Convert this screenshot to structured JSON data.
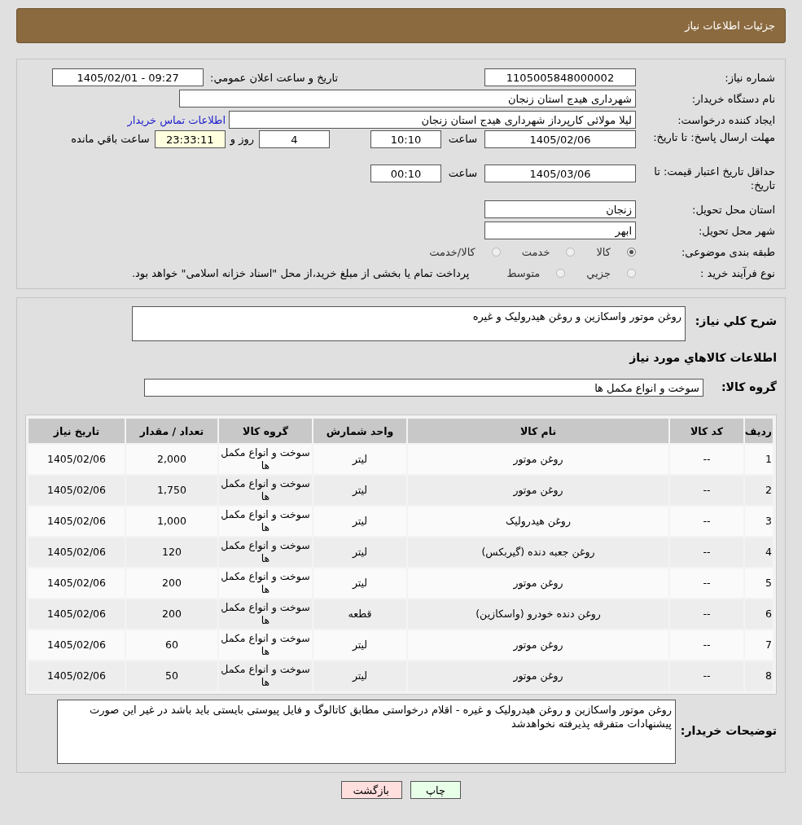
{
  "header": {
    "title": "جزئیات اطلاعات نیاز"
  },
  "info": {
    "need_number": {
      "label": "شماره نیاز:",
      "value": "1105005848000002"
    },
    "announce": {
      "label": "تاریخ و ساعت اعلان عمومي:",
      "value": "1405/02/01 - 09:27"
    },
    "buyer_org": {
      "label": "نام دستگاه خریدار:",
      "value": "شهرداری هیدج استان زنجان"
    },
    "requester": {
      "label": "ایجاد کننده درخواست:",
      "value": "لیلا مولائی کارپرداز شهرداری هیدج استان زنجان",
      "link": "اطلاعات تماس خریدار"
    },
    "deadline": {
      "label": "مهلت ارسال پاسخ: تا تاریخ:",
      "date": "1405/02/06",
      "time_label": "ساعت",
      "time": "10:10",
      "days": "4",
      "days_label": "روز و",
      "remaining": "23:33:11",
      "remaining_label": "ساعت باقي مانده"
    },
    "validity": {
      "label": "حداقل تاریخ اعتبار قیمت: تا تاریخ:",
      "date": "1405/03/06",
      "time_label": "ساعت",
      "time": "00:10"
    },
    "province": {
      "label": "استان محل تحویل:",
      "value": "زنجان"
    },
    "city": {
      "label": "شهر محل تحویل:",
      "value": "ابهر"
    },
    "category": {
      "label": "طبقه بندی موضوعی:",
      "options": [
        {
          "label": "کالا",
          "selected": true
        },
        {
          "label": "خدمت",
          "selected": false
        },
        {
          "label": "کالا/خدمت",
          "selected": false
        }
      ]
    },
    "purchase_type": {
      "label": "نوع فرآیند خرید :",
      "options": [
        {
          "label": "جزيي",
          "selected": false
        },
        {
          "label": "متوسط",
          "selected": false
        }
      ],
      "note": "پرداخت تمام یا بخشی از مبلغ خرید،از محل \"اسناد خزانه اسلامی\" خواهد بود."
    }
  },
  "summary": {
    "label": "شرح كلي نياز:",
    "value": "روغن موتور واسکازین و روغن هیدرولیک و غیره"
  },
  "goods_heading": "اطلاعات كالاهاي مورد نياز",
  "goods_group": {
    "label": "گروه كالا:",
    "value": "سوخت و انواع مکمل ها"
  },
  "table": {
    "columns": [
      "ردیف",
      "کد کالا",
      "نام کالا",
      "واحد شمارش",
      "گروه کالا",
      "تعداد / مقدار",
      "تاریخ نیاز"
    ],
    "rows": [
      [
        "1",
        "--",
        "روغن موتور",
        "لیتر",
        "سوخت و انواع مکمل ها",
        "2,000",
        "1405/02/06"
      ],
      [
        "2",
        "--",
        "روغن موتور",
        "لیتر",
        "سوخت و انواع مکمل ها",
        "1,750",
        "1405/02/06"
      ],
      [
        "3",
        "--",
        "روغن هیدرولیک",
        "لیتر",
        "سوخت و انواع مکمل ها",
        "1,000",
        "1405/02/06"
      ],
      [
        "4",
        "--",
        "روغن جعبه دنده (گیربکس)",
        "لیتر",
        "سوخت و انواع مکمل ها",
        "120",
        "1405/02/06"
      ],
      [
        "5",
        "--",
        "روغن موتور",
        "لیتر",
        "سوخت و انواع مکمل ها",
        "200",
        "1405/02/06"
      ],
      [
        "6",
        "--",
        "روغن دنده خودرو (واسکازین)",
        "قطعه",
        "سوخت و انواع مکمل ها",
        "200",
        "1405/02/06"
      ],
      [
        "7",
        "--",
        "روغن موتور",
        "لیتر",
        "سوخت و انواع مکمل ها",
        "60",
        "1405/02/06"
      ],
      [
        "8",
        "--",
        "روغن موتور",
        "لیتر",
        "سوخت و انواع مکمل ها",
        "50",
        "1405/02/06"
      ]
    ]
  },
  "buyer_notes": {
    "label": "توضیحات خریدار:",
    "value": "روغن موتور واسکازین و روغن هیدرولیک و غیره - اقلام درخواستی مطابق کاتالوگ و فایل پیوستی بایستی باید باشد در غیر این صورت پیشنهادات متفرقه پذیرفته نخواهدشد"
  },
  "buttons": [
    {
      "label": "چاپ",
      "kind": "print"
    },
    {
      "label": "بازگشت",
      "kind": "back"
    }
  ]
}
